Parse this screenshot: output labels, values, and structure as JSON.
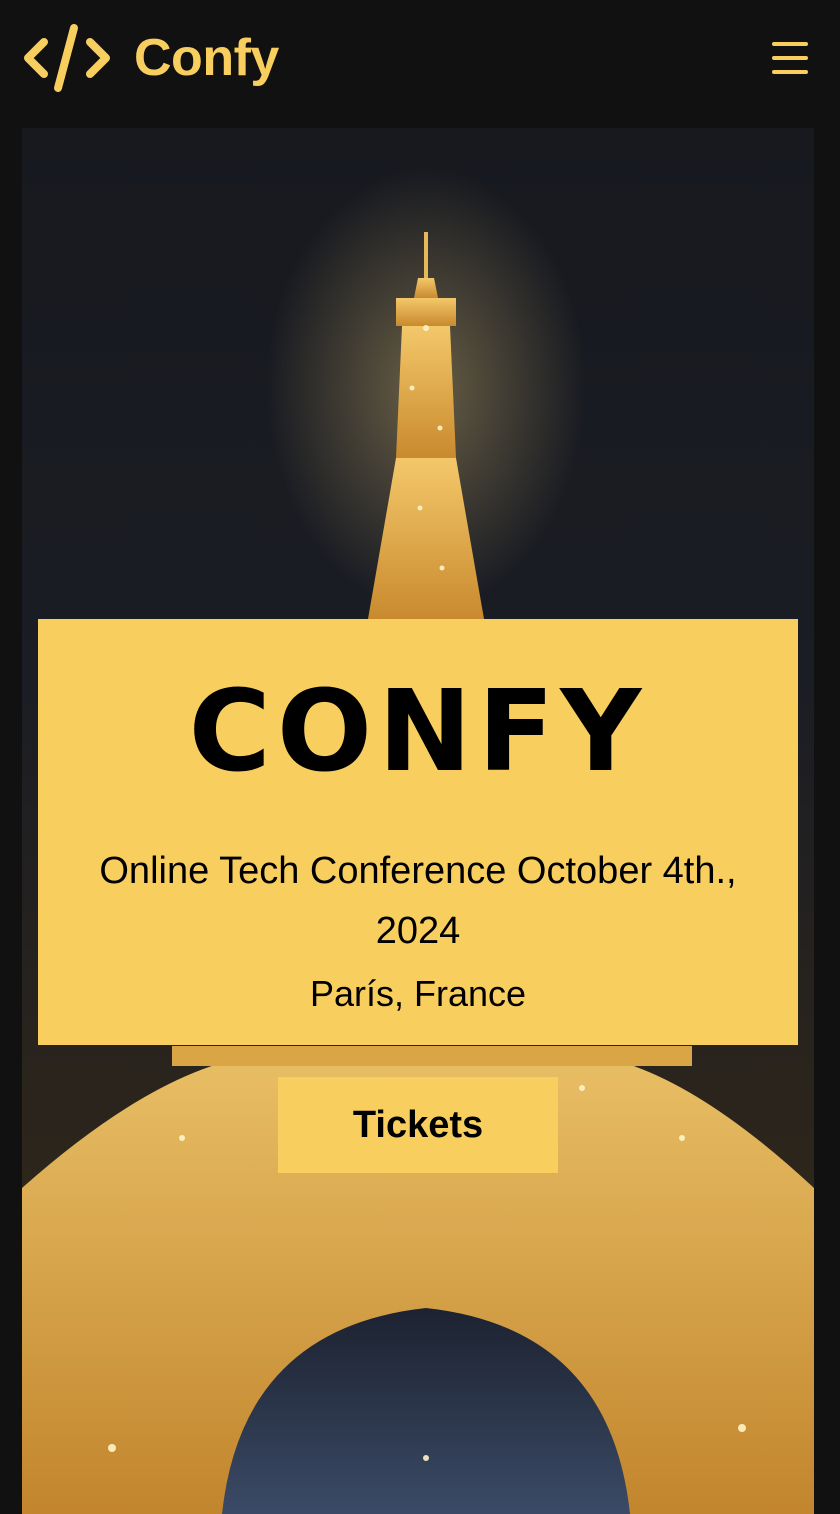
{
  "header": {
    "brand_name": "Confy",
    "logo_icon": "code-brackets-icon",
    "menu_icon": "hamburger-menu-icon"
  },
  "colors": {
    "accent": "#F8CF5E",
    "background": "#111111",
    "text": "#000000"
  },
  "hero": {
    "image": "eiffel-tower-night-photo",
    "title": "CONFY",
    "subtitle": "Online Tech Conference October 4th., 2024",
    "location": "París, France",
    "cta_label": "Tickets"
  }
}
